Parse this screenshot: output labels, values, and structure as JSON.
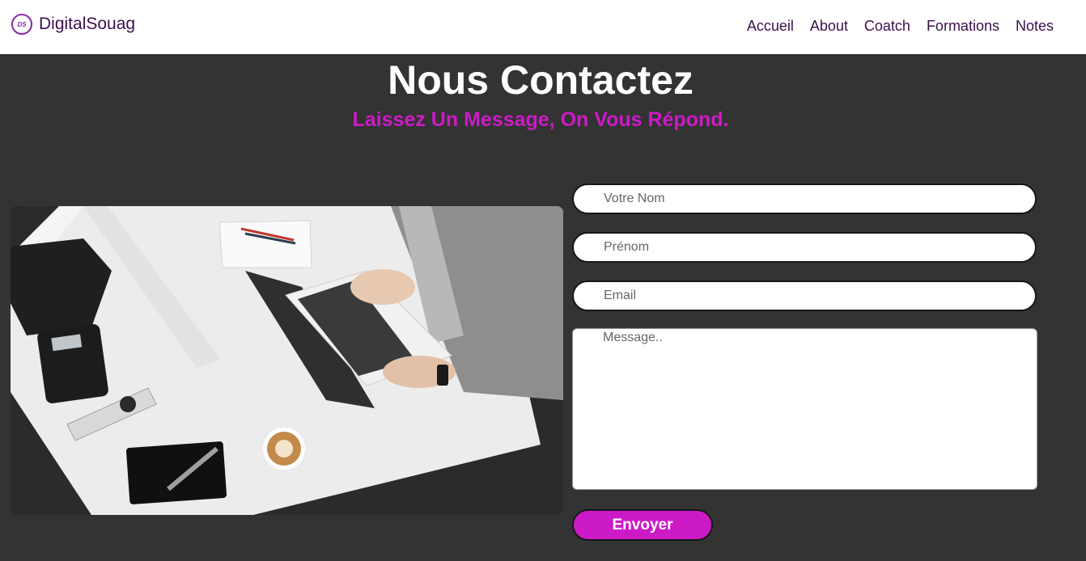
{
  "brand": {
    "name": "DigitalSouag",
    "logo_text": "DS"
  },
  "nav": {
    "items": [
      "Accueil",
      "About",
      "Coatch",
      "Formations",
      "Notes"
    ]
  },
  "contact": {
    "title": "Nous Contactez",
    "subtitle": "Laissez Un Message, On Vous Répond.",
    "name_placeholder": "Votre Nom",
    "firstname_placeholder": "Prénom",
    "email_placeholder": "Email",
    "message_placeholder": "Message..",
    "submit_label": "Envoyer"
  },
  "colors": {
    "accent": "#cc1bc6",
    "nav_text": "#3a0f4f",
    "background": "#333333"
  }
}
